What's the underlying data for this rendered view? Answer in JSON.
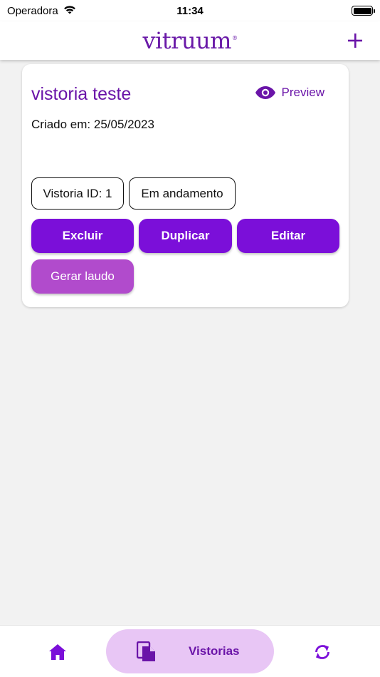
{
  "status_bar": {
    "carrier": "Operadora",
    "time": "11:34",
    "wifi_icon": "wifi-icon",
    "battery_icon": "battery-icon"
  },
  "header": {
    "logo_text": "vitruum",
    "logo_mark": "®",
    "add_icon": "plus-icon"
  },
  "card": {
    "title": "vistoria teste",
    "preview_label": "Preview",
    "preview_icon": "eye-icon",
    "created_text": "Criado em: 25/05/2023",
    "chips": {
      "id": "Vistoria ID: 1",
      "status": "Em andamento"
    },
    "buttons": {
      "delete": "Excluir",
      "duplicate": "Duplicar",
      "edit": "Editar",
      "report": "Gerar laudo"
    }
  },
  "bottom_nav": {
    "home_icon": "home-icon",
    "active_label": "Vistorias",
    "active_icon": "documents-icon",
    "sync_icon": "sync-icon"
  },
  "colors": {
    "primary": "#7b0fd9",
    "secondary": "#b14bcc",
    "brand_text": "#6a14a8",
    "nav_pill": "#e8c6f5",
    "background": "#f2f2f2"
  }
}
